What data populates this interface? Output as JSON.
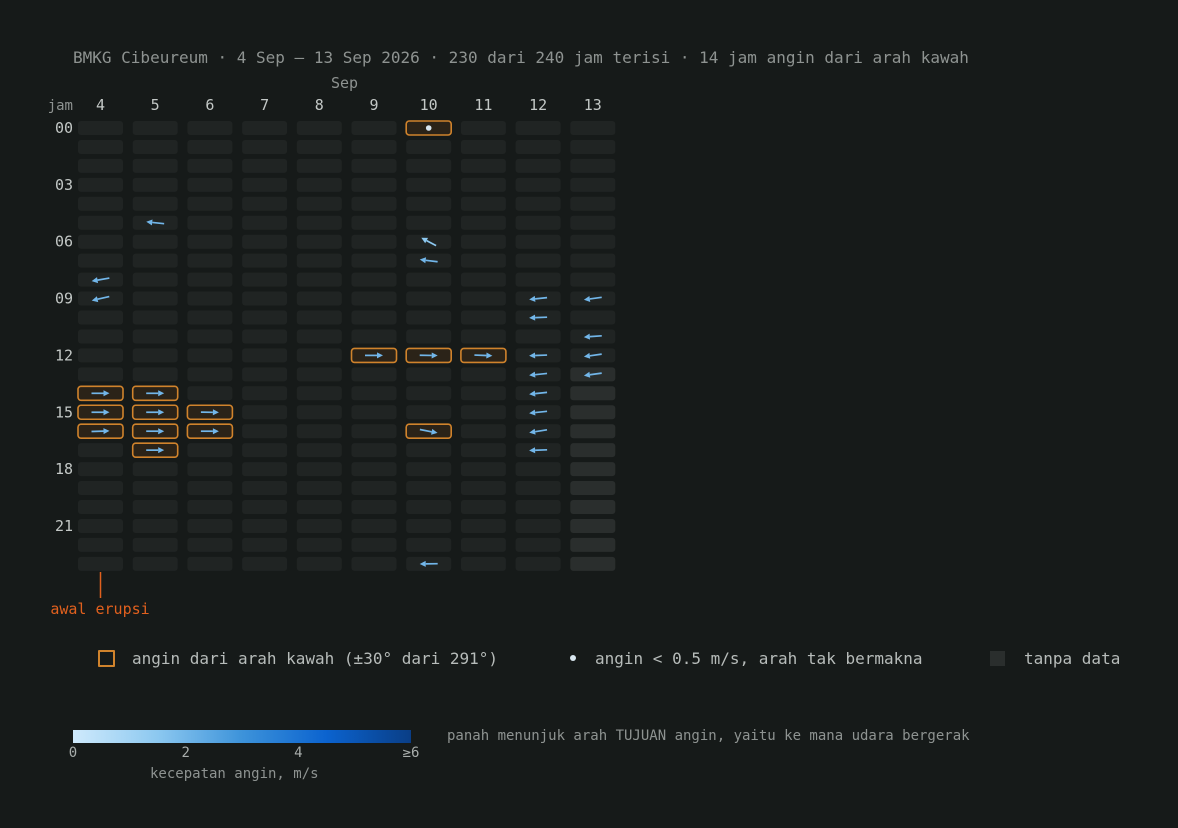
{
  "title": "BMKG Cibeureum · 4 Sep – 13 Sep 2026 · 230 dari 240 jam terisi · 14 jam angin dari arah kawah",
  "chart_data": {
    "type": "heatmap",
    "month_label": "Sep",
    "hour_axis_label": "jam",
    "days": [
      "4",
      "5",
      "6",
      "7",
      "8",
      "9",
      "10",
      "11",
      "12",
      "13"
    ],
    "hour_tick_labels": [
      "00",
      "03",
      "06",
      "09",
      "12",
      "15",
      "18",
      "21"
    ],
    "hour_ticks": [
      0,
      3,
      6,
      9,
      12,
      15,
      18,
      21
    ],
    "no_data_cells": [
      [
        9,
        13
      ],
      [
        9,
        14
      ],
      [
        9,
        15
      ],
      [
        9,
        16
      ],
      [
        9,
        17
      ],
      [
        9,
        18
      ],
      [
        9,
        19
      ],
      [
        9,
        20
      ],
      [
        9,
        21
      ],
      [
        9,
        22
      ],
      [
        9,
        23
      ]
    ],
    "calm_cells": [
      [
        6,
        0
      ]
    ],
    "wind_arrows": [
      {
        "day_index": 0,
        "hour": 8,
        "to_deg": 260,
        "speed": 2.0
      },
      {
        "day_index": 0,
        "hour": 9,
        "to_deg": 257,
        "speed": 2.0
      },
      {
        "day_index": 0,
        "hour": 14,
        "to_deg": 90,
        "speed": 2.0,
        "from_crater": true
      },
      {
        "day_index": 0,
        "hour": 15,
        "to_deg": 90,
        "speed": 2.0,
        "from_crater": true
      },
      {
        "day_index": 0,
        "hour": 16,
        "to_deg": 88,
        "speed": 2.0,
        "from_crater": true
      },
      {
        "day_index": 1,
        "hour": 5,
        "to_deg": 276,
        "speed": 2.0
      },
      {
        "day_index": 1,
        "hour": 14,
        "to_deg": 90,
        "speed": 2.0,
        "from_crater": true
      },
      {
        "day_index": 1,
        "hour": 15,
        "to_deg": 90,
        "speed": 2.0,
        "from_crater": true
      },
      {
        "day_index": 1,
        "hour": 16,
        "to_deg": 90,
        "speed": 2.0,
        "from_crater": true
      },
      {
        "day_index": 1,
        "hour": 17,
        "to_deg": 90,
        "speed": 2.0,
        "from_crater": true
      },
      {
        "day_index": 2,
        "hour": 15,
        "to_deg": 91,
        "speed": 2.0,
        "from_crater": true
      },
      {
        "day_index": 2,
        "hour": 16,
        "to_deg": 90,
        "speed": 2.0,
        "from_crater": true
      },
      {
        "day_index": 5,
        "hour": 12,
        "to_deg": 90,
        "speed": 2.0,
        "from_crater": true
      },
      {
        "day_index": 6,
        "hour": 6,
        "to_deg": 298,
        "speed": 1.5
      },
      {
        "day_index": 6,
        "hour": 7,
        "to_deg": 277,
        "speed": 2.0
      },
      {
        "day_index": 6,
        "hour": 12,
        "to_deg": 91,
        "speed": 2.0,
        "from_crater": true
      },
      {
        "day_index": 6,
        "hour": 16,
        "to_deg": 101,
        "speed": 2.0,
        "from_crater": true
      },
      {
        "day_index": 6,
        "hour": 23,
        "to_deg": 269,
        "speed": 2.0
      },
      {
        "day_index": 7,
        "hour": 12,
        "to_deg": 92,
        "speed": 2.0,
        "from_crater": true
      },
      {
        "day_index": 8,
        "hour": 9,
        "to_deg": 264,
        "speed": 2.0
      },
      {
        "day_index": 8,
        "hour": 10,
        "to_deg": 268,
        "speed": 2.0
      },
      {
        "day_index": 8,
        "hour": 12,
        "to_deg": 268,
        "speed": 2.0
      },
      {
        "day_index": 8,
        "hour": 13,
        "to_deg": 264,
        "speed": 2.0
      },
      {
        "day_index": 8,
        "hour": 14,
        "to_deg": 264,
        "speed": 2.0
      },
      {
        "day_index": 8,
        "hour": 15,
        "to_deg": 264,
        "speed": 2.0
      },
      {
        "day_index": 8,
        "hour": 16,
        "to_deg": 261,
        "speed": 2.0
      },
      {
        "day_index": 8,
        "hour": 17,
        "to_deg": 268,
        "speed": 2.0
      },
      {
        "day_index": 9,
        "hour": 9,
        "to_deg": 262,
        "speed": 2.0
      },
      {
        "day_index": 9,
        "hour": 11,
        "to_deg": 266,
        "speed": 2.0
      },
      {
        "day_index": 9,
        "hour": 12,
        "to_deg": 262,
        "speed": 2.0
      },
      {
        "day_index": 9,
        "hour": 13,
        "to_deg": 262,
        "speed": 2.0
      }
    ],
    "annotation": {
      "label": "awal erupsi",
      "day_index": 0,
      "hour": 0
    },
    "colors": {
      "background": "#161a19",
      "cell": "#202423",
      "no_data": "#2a2e2d",
      "crater_outline": "#d0832c",
      "crater_fill": "#2b2318",
      "arrow": "#8cc8f0",
      "annotation": "#e0601e"
    }
  },
  "legend": {
    "crater_label": "angin dari arah kawah (±30° dari 291°)",
    "calm_label": "angin < 0.5 m/s, arah tak bermakna",
    "nodata_label": "tanpa data"
  },
  "colorbar": {
    "label": "kecepatan angin, m/s",
    "ticks": [
      {
        "value": 0,
        "label": "0"
      },
      {
        "value": 2,
        "label": "2"
      },
      {
        "value": 4,
        "label": "4"
      },
      {
        "value": 6,
        "label": "≥6"
      }
    ],
    "min": 0,
    "max": 6,
    "gradient": [
      "#cfeafc",
      "#8cc8f0",
      "#3d93da",
      "#0b63cf",
      "#0a3e86"
    ]
  },
  "note": "panah menunjuk arah TUJUAN angin, yaitu ke mana udara bergerak"
}
